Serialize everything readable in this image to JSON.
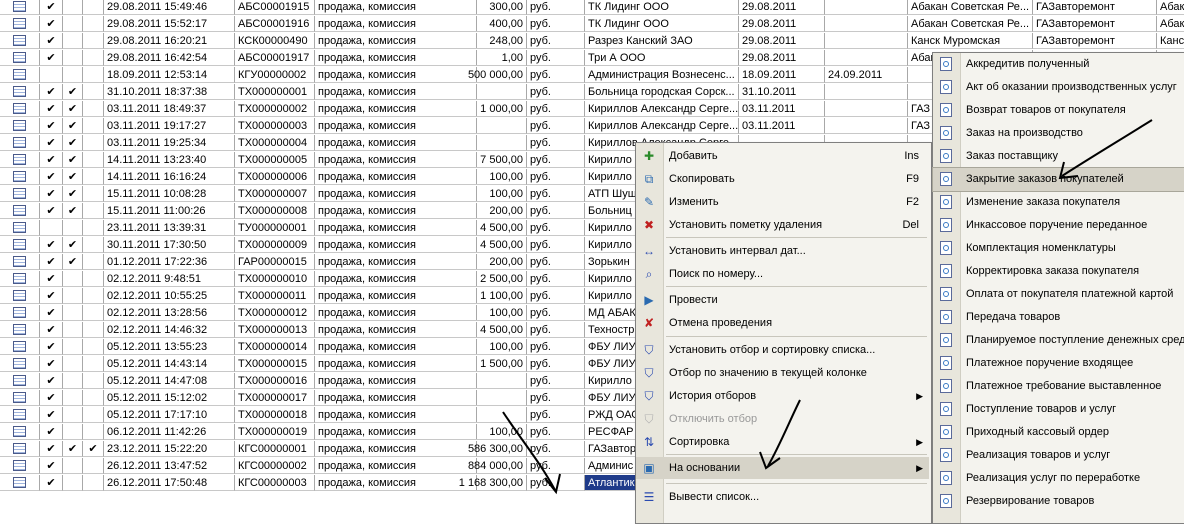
{
  "table": {
    "rows": [
      {
        "c1": "✔",
        "c2": "",
        "c3": "",
        "date": "29.08.2011 15:49:46",
        "num": "АБС00001915",
        "op": "продажа, комиссия",
        "sum": "300,00",
        "cur": "руб.",
        "cp": "ТК Лидинг ООО",
        "d1": "29.08.2011",
        "d2": "",
        "st": "Абакан Советская Ре...",
        "org": "ГАЗавторемонт",
        "ex": "Абака"
      },
      {
        "c1": "✔",
        "c2": "",
        "c3": "",
        "date": "29.08.2011 15:52:17",
        "num": "АБС00001916",
        "op": "продажа, комиссия",
        "sum": "400,00",
        "cur": "руб.",
        "cp": "ТК Лидинг ООО",
        "d1": "29.08.2011",
        "d2": "",
        "st": "Абакан Советская Ре...",
        "org": "ГАЗавторемонт",
        "ex": "Абака"
      },
      {
        "c1": "✔",
        "c2": "",
        "c3": "",
        "date": "29.08.2011 16:20:21",
        "num": "КСК00000490",
        "op": "продажа, комиссия",
        "sum": "248,00",
        "cur": "руб.",
        "cp": "Разрез Канский ЗАО",
        "d1": "29.08.2011",
        "d2": "",
        "st": "Канск Муромская",
        "org": "ГАЗавторемонт",
        "ex": "Канск"
      },
      {
        "c1": "✔",
        "c2": "",
        "c3": "",
        "date": "29.08.2011 16:42:54",
        "num": "АБС00001917",
        "op": "продажа, комиссия",
        "sum": "1,00",
        "cur": "руб.",
        "cp": "Три А ООО",
        "d1": "29.08.2011",
        "d2": "",
        "st": "Абак",
        "org": "",
        "ex": ""
      },
      {
        "c1": "",
        "c2": "",
        "c3": "",
        "date": "18.09.2011 12:53:14",
        "num": "КГУ00000002",
        "op": "продажа, комиссия",
        "sum": "500 000,00",
        "cur": "руб.",
        "cp": "Администрация Вознесенс...",
        "d1": "18.09.2011",
        "d2": "24.09.2011",
        "st": "",
        "org": "",
        "ex": ""
      },
      {
        "c1": "✔",
        "c2": "✔",
        "c3": "",
        "date": "31.10.2011 18:37:38",
        "num": "ТХ000000001",
        "op": "продажа, комиссия",
        "sum": "",
        "cur": "руб.",
        "cp": "Больница городская Сорск...",
        "d1": "31.10.2011",
        "d2": "",
        "st": "",
        "org": "",
        "ex": ""
      },
      {
        "c1": "✔",
        "c2": "✔",
        "c3": "",
        "date": "03.11.2011 18:49:37",
        "num": "ТХ000000002",
        "op": "продажа, комиссия",
        "sum": "1 000,00",
        "cur": "руб.",
        "cp": "Кириллов Александр Серге...",
        "d1": "03.11.2011",
        "d2": "",
        "st": "ГАЗ",
        "org": "",
        "ex": ""
      },
      {
        "c1": "✔",
        "c2": "✔",
        "c3": "",
        "date": "03.11.2011 19:17:27",
        "num": "ТХ000000003",
        "op": "продажа, комиссия",
        "sum": "",
        "cur": "руб.",
        "cp": "Кириллов Александр Серге...",
        "d1": "03.11.2011",
        "d2": "",
        "st": "ГАЗ",
        "org": "",
        "ex": ""
      },
      {
        "c1": "✔",
        "c2": "✔",
        "c3": "",
        "date": "03.11.2011 19:25:34",
        "num": "ТХ000000004",
        "op": "продажа, комиссия",
        "sum": "",
        "cur": "руб.",
        "cp": "Кириллов Александр Серге...",
        "d1": "",
        "d2": "",
        "st": "",
        "org": "",
        "ex": ""
      },
      {
        "c1": "✔",
        "c2": "✔",
        "c3": "",
        "date": "14.11.2011 13:23:40",
        "num": "ТХ000000005",
        "op": "продажа, комиссия",
        "sum": "7 500,00",
        "cur": "руб.",
        "cp": "Кирилло",
        "d1": "",
        "d2": "",
        "st": "",
        "org": "",
        "ex": ""
      },
      {
        "c1": "✔",
        "c2": "✔",
        "c3": "",
        "date": "14.11.2011 16:16:24",
        "num": "ТХ000000006",
        "op": "продажа, комиссия",
        "sum": "100,00",
        "cur": "руб.",
        "cp": "Кирилло",
        "d1": "",
        "d2": "",
        "st": "",
        "org": "",
        "ex": ""
      },
      {
        "c1": "✔",
        "c2": "✔",
        "c3": "",
        "date": "15.11.2011 10:08:28",
        "num": "ТХ000000007",
        "op": "продажа, комиссия",
        "sum": "100,00",
        "cur": "руб.",
        "cp": "АТП Шуш",
        "d1": "",
        "d2": "",
        "st": "",
        "org": "",
        "ex": ""
      },
      {
        "c1": "✔",
        "c2": "✔",
        "c3": "",
        "date": "15.11.2011 11:00:26",
        "num": "ТХ000000008",
        "op": "продажа, комиссия",
        "sum": "200,00",
        "cur": "руб.",
        "cp": "Больниц",
        "d1": "",
        "d2": "",
        "st": "",
        "org": "",
        "ex": ""
      },
      {
        "c1": "",
        "c2": "",
        "c3": "",
        "date": "23.11.2011 13:39:31",
        "num": "ТУ000000001",
        "op": "продажа, комиссия",
        "sum": "4 500,00",
        "cur": "руб.",
        "cp": "Кирилло",
        "d1": "",
        "d2": "",
        "st": "",
        "org": "",
        "ex": ""
      },
      {
        "c1": "✔",
        "c2": "✔",
        "c3": "",
        "date": "30.11.2011 17:30:50",
        "num": "ТХ000000009",
        "op": "продажа, комиссия",
        "sum": "4 500,00",
        "cur": "руб.",
        "cp": "Кирилло",
        "d1": "",
        "d2": "",
        "st": "",
        "org": "",
        "ex": ""
      },
      {
        "c1": "✔",
        "c2": "✔",
        "c3": "",
        "date": "01.12.2011 17:22:36",
        "num": "ГАР00000015",
        "op": "продажа, комиссия",
        "sum": "200,00",
        "cur": "руб.",
        "cp": "Зорькин",
        "d1": "",
        "d2": "",
        "st": "",
        "org": "",
        "ex": ""
      },
      {
        "c1": "✔",
        "c2": "",
        "c3": "",
        "date": "02.12.2011 9:48:51",
        "num": "ТХ000000010",
        "op": "продажа, комиссия",
        "sum": "2 500,00",
        "cur": "руб.",
        "cp": "Кирилло",
        "d1": "",
        "d2": "",
        "st": "",
        "org": "",
        "ex": ""
      },
      {
        "c1": "✔",
        "c2": "",
        "c3": "",
        "date": "02.12.2011 10:55:25",
        "num": "ТХ000000011",
        "op": "продажа, комиссия",
        "sum": "1 100,00",
        "cur": "руб.",
        "cp": "Кирилло",
        "d1": "",
        "d2": "",
        "st": "",
        "org": "",
        "ex": ""
      },
      {
        "c1": "✔",
        "c2": "",
        "c3": "",
        "date": "02.12.2011 13:28:56",
        "num": "ТХ000000012",
        "op": "продажа, комиссия",
        "sum": "100,00",
        "cur": "руб.",
        "cp": "МД АБАК",
        "d1": "",
        "d2": "",
        "st": "",
        "org": "",
        "ex": ""
      },
      {
        "c1": "✔",
        "c2": "",
        "c3": "",
        "date": "02.12.2011 14:46:32",
        "num": "ТХ000000013",
        "op": "продажа, комиссия",
        "sum": "4 500,00",
        "cur": "руб.",
        "cp": "Техностр",
        "d1": "",
        "d2": "",
        "st": "",
        "org": "",
        "ex": ""
      },
      {
        "c1": "✔",
        "c2": "",
        "c3": "",
        "date": "05.12.2011 13:55:23",
        "num": "ТХ000000014",
        "op": "продажа, комиссия",
        "sum": "100,00",
        "cur": "руб.",
        "cp": "ФБУ ЛИУ",
        "d1": "",
        "d2": "",
        "st": "",
        "org": "",
        "ex": ""
      },
      {
        "c1": "✔",
        "c2": "",
        "c3": "",
        "date": "05.12.2011 14:43:14",
        "num": "ТХ000000015",
        "op": "продажа, комиссия",
        "sum": "1 500,00",
        "cur": "руб.",
        "cp": "ФБУ ЛИУ",
        "d1": "",
        "d2": "",
        "st": "",
        "org": "",
        "ex": ""
      },
      {
        "c1": "✔",
        "c2": "",
        "c3": "",
        "date": "05.12.2011 14:47:08",
        "num": "ТХ000000016",
        "op": "продажа, комиссия",
        "sum": "",
        "cur": "руб.",
        "cp": "Кирилло",
        "d1": "",
        "d2": "",
        "st": "",
        "org": "",
        "ex": ""
      },
      {
        "c1": "✔",
        "c2": "",
        "c3": "",
        "date": "05.12.2011 15:12:02",
        "num": "ТХ000000017",
        "op": "продажа, комиссия",
        "sum": "",
        "cur": "руб.",
        "cp": "ФБУ ЛИУ",
        "d1": "",
        "d2": "",
        "st": "",
        "org": "",
        "ex": ""
      },
      {
        "c1": "✔",
        "c2": "",
        "c3": "",
        "date": "05.12.2011 17:17:10",
        "num": "ТХ000000018",
        "op": "продажа, комиссия",
        "sum": "",
        "cur": "руб.",
        "cp": "РЖД ОАС",
        "d1": "",
        "d2": "",
        "st": "",
        "org": "",
        "ex": ""
      },
      {
        "c1": "✔",
        "c2": "",
        "c3": "",
        "date": "06.12.2011 11:42:26",
        "num": "ТХ000000019",
        "op": "продажа, комиссия",
        "sum": "100,00",
        "cur": "руб.",
        "cp": "РЕСФАР",
        "d1": "",
        "d2": "",
        "st": "",
        "org": "",
        "ex": ""
      },
      {
        "c1": "✔",
        "c2": "✔",
        "c3": "✔",
        "date": "23.12.2011 15:22:20",
        "num": "КГС00000001",
        "op": "продажа, комиссия",
        "sum": "586 300,00",
        "cur": "руб.",
        "cp": "ГАЗавтор",
        "d1": "",
        "d2": "",
        "st": "",
        "org": "",
        "ex": ""
      },
      {
        "c1": "✔",
        "c2": "",
        "c3": "",
        "date": "26.12.2011 13:47:52",
        "num": "КГС00000002",
        "op": "продажа, комиссия",
        "sum": "884 000,00",
        "cur": "руб.",
        "cp": "Админис",
        "d1": "",
        "d2": "",
        "st": "",
        "org": "",
        "ex": ""
      },
      {
        "c1": "✔",
        "c2": "",
        "c3": "",
        "date": "26.12.2011 17:50:48",
        "num": "КГС00000003",
        "op": "продажа, комиссия",
        "sum": "1 168 300,00",
        "cur": "руб.",
        "cp": "Атлантик",
        "d1": "",
        "d2": "",
        "st": "",
        "org": "",
        "ex": ""
      }
    ]
  },
  "context_menu": {
    "items": [
      {
        "label": "Добавить",
        "shortcut": "Ins",
        "icon": "add-icon",
        "glyph": "✚",
        "color": "#2a8a2a"
      },
      {
        "label": "Скопировать",
        "shortcut": "F9",
        "icon": "copy-icon",
        "glyph": "⧉",
        "color": "#2a6ab0"
      },
      {
        "label": "Изменить",
        "shortcut": "F2",
        "icon": "edit-icon",
        "glyph": "✎",
        "color": "#2a6ab0"
      },
      {
        "label": "Установить пометку удаления",
        "shortcut": "Del",
        "icon": "delete-mark-icon",
        "glyph": "✖",
        "color": "#c02020"
      },
      {
        "label": "Установить интервал дат...",
        "shortcut": "",
        "icon": "date-interval-icon",
        "glyph": "↔",
        "color": "#2a4ab0"
      },
      {
        "label": "Поиск по номеру...",
        "shortcut": "",
        "icon": "search-number-icon",
        "glyph": "⌕",
        "color": "#2a4ab0"
      },
      {
        "label": "Провести",
        "shortcut": "",
        "icon": "post-icon",
        "glyph": "▶",
        "color": "#2a6ab0"
      },
      {
        "label": "Отмена проведения",
        "shortcut": "",
        "icon": "unpost-icon",
        "glyph": "✘",
        "color": "#c02020"
      },
      {
        "label": "Установить отбор и сортировку списка...",
        "shortcut": "",
        "icon": "filter-sort-icon",
        "glyph": "⛉",
        "color": "#2a4ab0"
      },
      {
        "label": "Отбор по значению в текущей колонке",
        "shortcut": "",
        "icon": "filter-value-icon",
        "glyph": "⛉",
        "color": "#2a4ab0"
      },
      {
        "label": "История отборов",
        "shortcut": "",
        "icon": "filter-history-icon",
        "glyph": "⛉",
        "color": "#2a4ab0"
      },
      {
        "label": "Отключить отбор",
        "shortcut": "",
        "icon": "filter-off-icon",
        "glyph": "⛉",
        "color": "#b0b0b0"
      },
      {
        "label": "Сортировка",
        "shortcut": "",
        "icon": "sort-icon",
        "glyph": "⇅",
        "color": "#2a4ab0"
      },
      {
        "label": "На основании",
        "shortcut": "",
        "icon": "based-on-icon",
        "glyph": "▣",
        "color": "#2a6ab0"
      },
      {
        "label": "Вывести список...",
        "shortcut": "",
        "icon": "print-list-icon",
        "glyph": "☰",
        "color": "#2a4ab0"
      }
    ]
  },
  "submenu": {
    "items": [
      "Аккредитив полученный",
      "Акт об оказании производственных услуг",
      "Возврат товаров от покупателя",
      "Заказ на производство",
      "Заказ поставщику",
      "Закрытие заказов покупателей",
      "Изменение заказа покупателя",
      "Инкассовое поручение переданное",
      "Комплектация номенклатуры",
      "Корректировка заказа покупателя",
      "Оплата от покупателя платежной картой",
      "Передача товаров",
      "Планируемое поступление денежных средс",
      "Платежное поручение входящее",
      "Платежное требование выставленное",
      "Поступление товаров и услуг",
      "Приходный кассовый ордер",
      "Реализация товаров и услуг",
      "Реализация услуг по переработке",
      "Резервирование товаров"
    ]
  }
}
